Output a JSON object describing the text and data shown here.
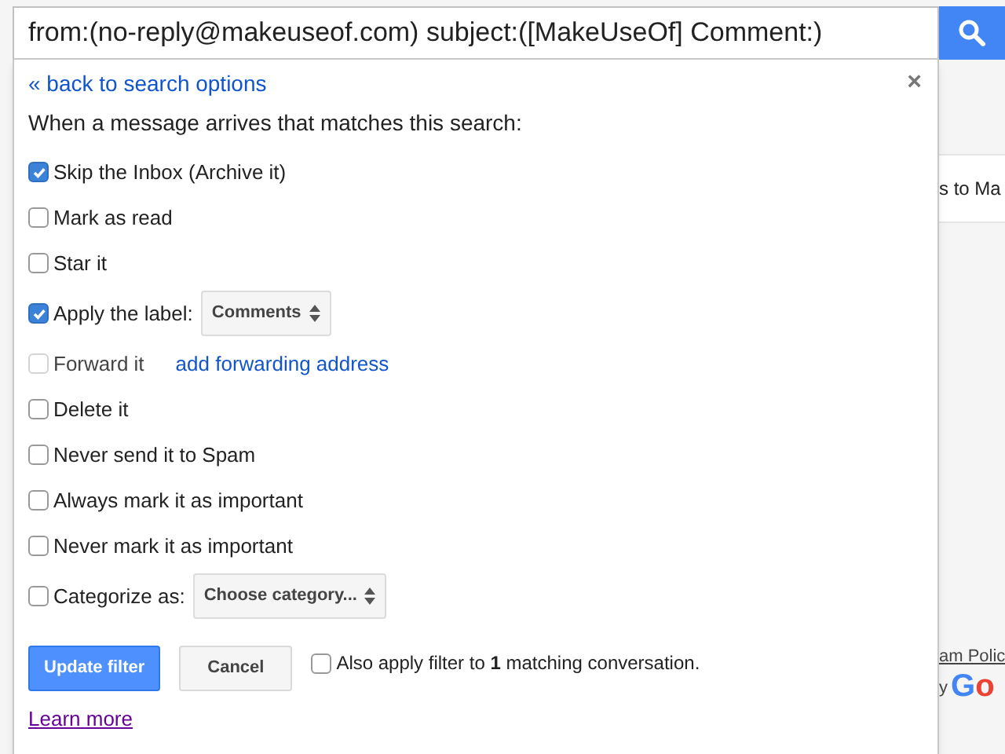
{
  "search": {
    "value": "from:(no-reply@makeuseof.com) subject:([MakeUseOf] Comment:)"
  },
  "filter_panel": {
    "back_link": "« back to search options",
    "close": "×",
    "heading": "When a message arrives that matches this search:",
    "options": [
      {
        "kind": "checkbox",
        "label": "Skip the Inbox (Archive it)",
        "checked": true,
        "disabled": false
      },
      {
        "kind": "checkbox",
        "label": "Mark as read",
        "checked": false,
        "disabled": false
      },
      {
        "kind": "checkbox",
        "label": "Star it",
        "checked": false,
        "disabled": false
      },
      {
        "kind": "select",
        "label": "Apply the label:",
        "checked": true,
        "disabled": false,
        "select": "Comments"
      },
      {
        "kind": "link",
        "label": "Forward it",
        "checked": false,
        "disabled": true,
        "link": "add forwarding address"
      },
      {
        "kind": "checkbox",
        "label": "Delete it",
        "checked": false,
        "disabled": false
      },
      {
        "kind": "checkbox",
        "label": "Never send it to Spam",
        "checked": false,
        "disabled": false
      },
      {
        "kind": "checkbox",
        "label": "Always mark it as important",
        "checked": false,
        "disabled": false
      },
      {
        "kind": "checkbox",
        "label": "Never mark it as important",
        "checked": false,
        "disabled": false
      },
      {
        "kind": "select",
        "label": "Categorize as:",
        "checked": false,
        "disabled": false,
        "select": "Choose category..."
      }
    ],
    "update_button": "Update filter",
    "cancel_button": "Cancel",
    "also_apply": {
      "label": "Also apply filter to **1** matching conversation.",
      "checked": false
    },
    "learn_more": "Learn more"
  },
  "background": {
    "row_text": "s to Ma",
    "policy_link": "am Polic",
    "powered_by": "y",
    "logo": "Go"
  }
}
